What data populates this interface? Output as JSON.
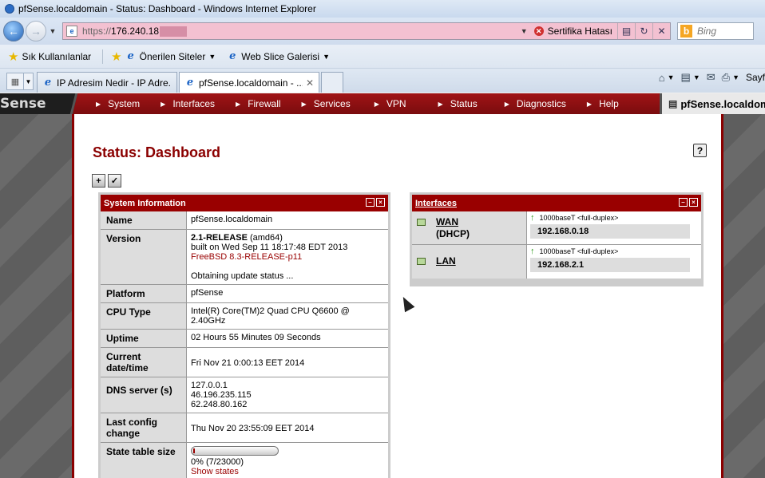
{
  "window": {
    "title": "pfSense.localdomain - Status: Dashboard - Windows Internet Explorer"
  },
  "address_bar": {
    "url_prefix": "https://",
    "url_host": "176.240.18",
    "cert_error": "Sertifika Hatası"
  },
  "search": {
    "placeholder": "Bing"
  },
  "favorites_bar": {
    "favorites_label": "Sık Kullanılanlar",
    "items": [
      "Önerilen Siteler",
      "Web Slice Galerisi"
    ]
  },
  "tabs": [
    {
      "title": "IP Adresim Nedir - IP Adre..."
    },
    {
      "title": "pfSense.localdomain - ..."
    }
  ],
  "tools": {
    "page_label": "Sayf"
  },
  "pf_menu": {
    "logo": "Sense",
    "items": [
      "System",
      "Interfaces",
      "Firewall",
      "Services",
      "VPN",
      "Status",
      "Diagnostics",
      "Help"
    ],
    "hostname": "pfSense.localdom"
  },
  "page": {
    "title": "Status: Dashboard",
    "help": "?"
  },
  "system_information": {
    "title": "System Information",
    "rows": {
      "name": {
        "label": "Name",
        "value": "pfSense.localdomain"
      },
      "version": {
        "label": "Version",
        "release": "2.1-RELEASE",
        "arch": " (amd64)",
        "built": "built on Wed Sep 11 18:17:48 EDT 2013",
        "freebsd": "FreeBSD 8.3-RELEASE-p11",
        "update": "Obtaining update status ..."
      },
      "platform": {
        "label": "Platform",
        "value": "pfSense"
      },
      "cpu": {
        "label": "CPU Type",
        "value": "Intel(R) Core(TM)2 Quad CPU Q6600 @ 2.40GHz"
      },
      "uptime": {
        "label": "Uptime",
        "value": "02 Hours 55 Minutes 09 Seconds"
      },
      "datetime": {
        "label": "Current date/time",
        "value": "Fri Nov 21 0:00:13 EET 2014"
      },
      "dns": {
        "label": "DNS server (s)",
        "servers": [
          "127.0.0.1",
          "46.196.235.115",
          "62.248.80.162"
        ]
      },
      "config": {
        "label": "Last config change",
        "value": "Thu Nov 20 23:55:09 EET 2014"
      },
      "state": {
        "label": "State table size",
        "value": "0% (7/23000)",
        "link": "Show states",
        "fraction": 0.0003
      }
    }
  },
  "interfaces": {
    "title": "Interfaces",
    "rows": [
      {
        "name": "WAN",
        "sub": "(DHCP)",
        "media": "1000baseT <full-duplex>",
        "ip": "192.168.0.18"
      },
      {
        "name": "LAN",
        "sub": "",
        "media": "1000baseT <full-duplex>",
        "ip": "192.168.2.1"
      }
    ]
  }
}
